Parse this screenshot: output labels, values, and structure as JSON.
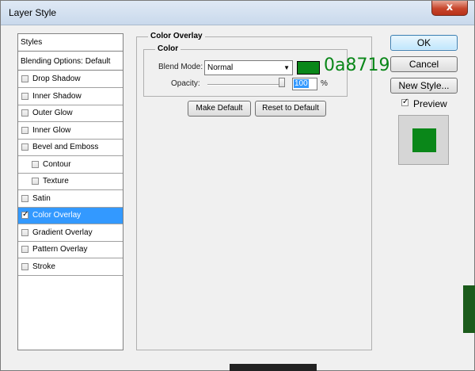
{
  "window": {
    "title": "Layer Style",
    "close_glyph": "x"
  },
  "styles_list": {
    "header": "Styles",
    "blending_options": "Blending Options: Default",
    "items": [
      {
        "label": "Drop Shadow",
        "checked": false,
        "indent": false
      },
      {
        "label": "Inner Shadow",
        "checked": false,
        "indent": false
      },
      {
        "label": "Outer Glow",
        "checked": false,
        "indent": false
      },
      {
        "label": "Inner Glow",
        "checked": false,
        "indent": false
      },
      {
        "label": "Bevel and Emboss",
        "checked": false,
        "indent": false
      },
      {
        "label": "Contour",
        "checked": false,
        "indent": true
      },
      {
        "label": "Texture",
        "checked": false,
        "indent": true
      },
      {
        "label": "Satin",
        "checked": false,
        "indent": false
      },
      {
        "label": "Color Overlay",
        "checked": true,
        "indent": false,
        "selected": true
      },
      {
        "label": "Gradient Overlay",
        "checked": false,
        "indent": false
      },
      {
        "label": "Pattern Overlay",
        "checked": false,
        "indent": false
      },
      {
        "label": "Stroke",
        "checked": false,
        "indent": false
      }
    ]
  },
  "color_overlay": {
    "section_title": "Color Overlay",
    "group_title": "Color",
    "blend_mode_label": "Blend Mode:",
    "blend_mode_value": "Normal",
    "color_hex_text": "0a8719",
    "overlay_color": "#0a8719",
    "opacity_label": "Opacity:",
    "opacity_value": "100",
    "opacity_unit": "%",
    "make_default": "Make Default",
    "reset_to_default": "Reset to Default"
  },
  "actions": {
    "ok": "OK",
    "cancel": "Cancel",
    "new_style": "New Style...",
    "preview_label": "Preview",
    "preview_checked": true
  },
  "colors": {
    "selection": "#3399ff",
    "overlay": "#0a8719"
  }
}
